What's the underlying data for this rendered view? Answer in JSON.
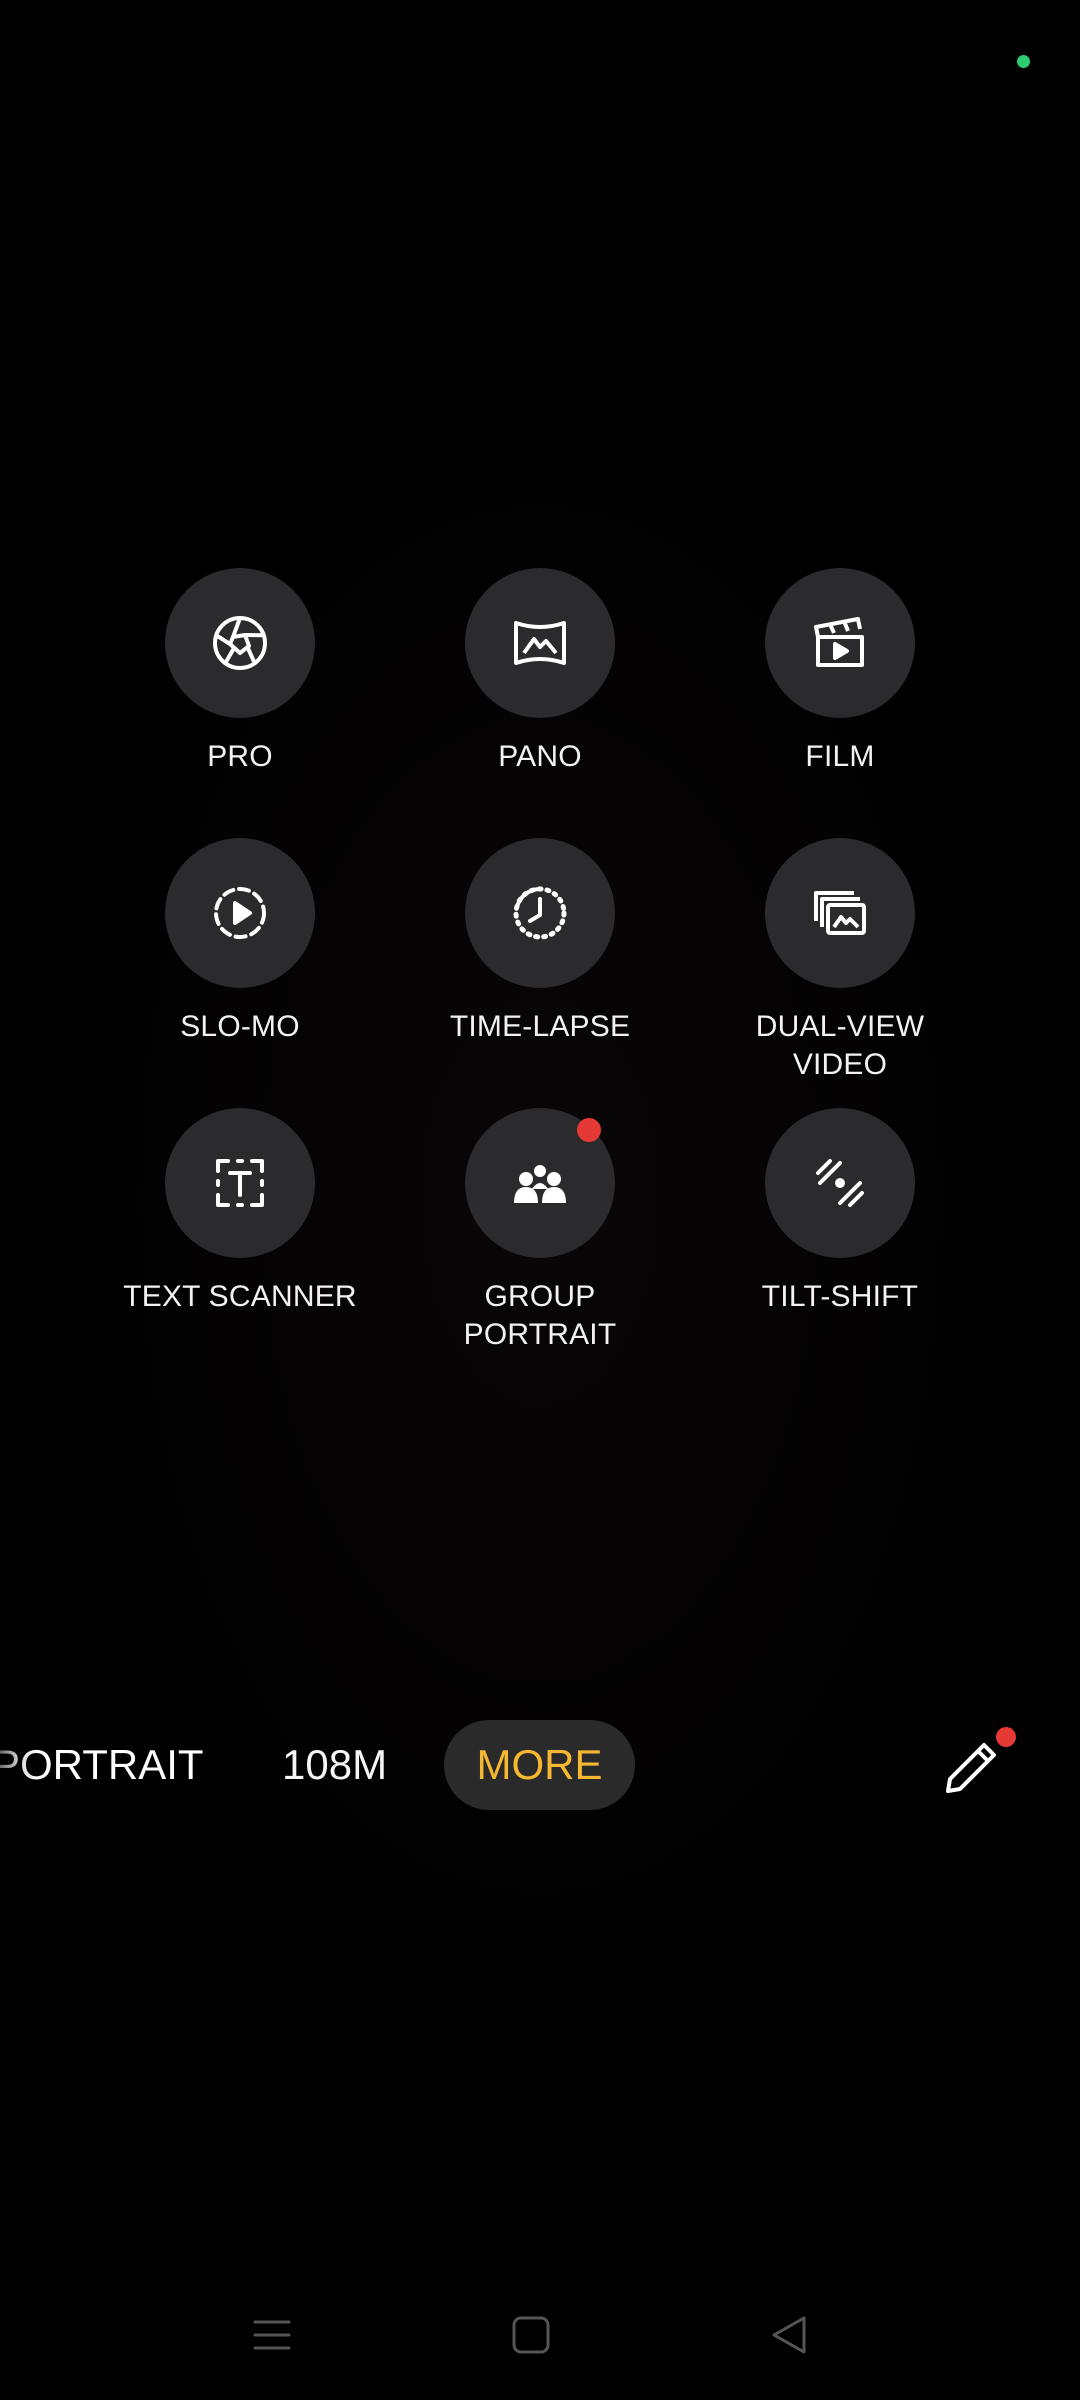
{
  "modes": [
    {
      "id": "pro",
      "label": "PRO",
      "icon": "aperture-icon",
      "badge": false
    },
    {
      "id": "pano",
      "label": "PANO",
      "icon": "panorama-icon",
      "badge": false
    },
    {
      "id": "film",
      "label": "FILM",
      "icon": "clapperboard-icon",
      "badge": false
    },
    {
      "id": "slo-mo",
      "label": "SLO-MO",
      "icon": "slow-motion-icon",
      "badge": false
    },
    {
      "id": "time-lapse",
      "label": "TIME-LAPSE",
      "icon": "time-lapse-icon",
      "badge": false
    },
    {
      "id": "dual-view-video",
      "label": "DUAL-VIEW\nVIDEO",
      "icon": "dual-view-icon",
      "badge": false
    },
    {
      "id": "text-scanner",
      "label": "TEXT SCANNER",
      "icon": "text-scan-icon",
      "badge": false
    },
    {
      "id": "group-portrait",
      "label": "GROUP\nPORTRAIT",
      "icon": "group-icon",
      "badge": true
    },
    {
      "id": "tilt-shift",
      "label": "TILT-SHIFT",
      "icon": "tilt-shift-icon",
      "badge": false
    }
  ],
  "mode_bar": {
    "portrait": "PORTRAIT",
    "megapixel": "108M",
    "more": "MORE",
    "edit_icon": "pencil-icon",
    "edit_badge": true
  },
  "nav": {
    "menu_icon": "menu-icon",
    "home_icon": "home-icon",
    "back_icon": "back-icon"
  },
  "colors": {
    "accent": "#f6b830",
    "badge": "#e53935",
    "status_dot": "#2ecc71",
    "circle_bg": "#2b2b2d"
  }
}
